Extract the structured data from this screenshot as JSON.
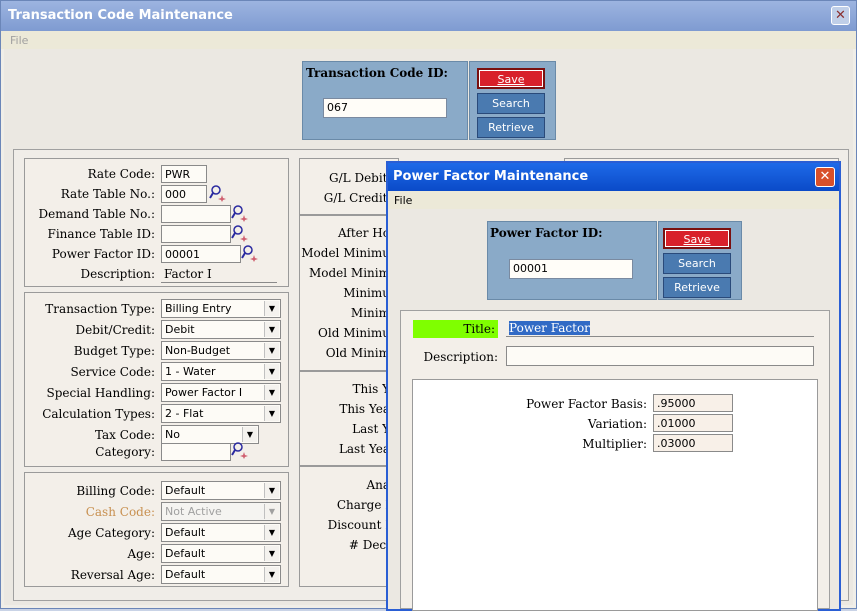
{
  "main": {
    "title": "Transaction Code Maintenance",
    "menu": [
      "File"
    ],
    "id_label": "Transaction Code ID:",
    "id_value": "067",
    "buttons": {
      "save": "Save",
      "search": "Search",
      "retrieve": "Retrieve"
    },
    "group1": {
      "rate_code_label": "Rate Code:",
      "rate_code": "PWR",
      "rate_table_label": "Rate Table No.:",
      "rate_table": "000",
      "demand_table_label": "Demand Table No.:",
      "demand_table": "",
      "finance_table_label": "Finance Table ID:",
      "finance_table": "",
      "power_factor_label": "Power Factor ID:",
      "power_factor": "00001",
      "description_label": "Description:",
      "description": "Factor I"
    },
    "group2": {
      "transaction_type_label": "Transaction Type:",
      "transaction_type": "Billing Entry",
      "debit_credit_label": "Debit/Credit:",
      "debit_credit": "Debit",
      "budget_type_label": "Budget Type:",
      "budget_type": "Non-Budget",
      "service_code_label": "Service Code:",
      "service_code": "1 - Water",
      "special_handling_label": "Special Handling:",
      "special_handling": "Power Factor I",
      "calculation_types_label": "Calculation Types:",
      "calculation_types": "2 - Flat",
      "tax_code_label": "Tax Code:",
      "tax_code": "No",
      "category_label": "Category:",
      "category": ""
    },
    "group3": {
      "billing_code_label": "Billing Code:",
      "billing_code": "Default",
      "cash_code_label": "Cash Code:",
      "cash_code": "Not Active",
      "age_category_label": "Age Category:",
      "age_category": "Default",
      "age_label": "Age:",
      "age": "Default",
      "reversal_age_label": "Reversal Age:",
      "reversal_age": "Default"
    },
    "mid": {
      "gl_debit": "G/L Debit A",
      "gl_credit": "G/L Credit A",
      "after_ho": "After Ho",
      "model_min1": "Model Minimu",
      "model_min2": "Model Minim",
      "minimu": "Minimu",
      "minim": "Minim",
      "old_min1": "Old Minimu",
      "old_min2": "Old Minim",
      "this_y": "This Y",
      "this_yea": "This Yea",
      "last_y": "Last Y",
      "last_yea": "Last Yea",
      "ana": "Ana",
      "charge": "Charge I",
      "discount": "Discount I",
      "deci": "# Deci"
    }
  },
  "dialog": {
    "title": "Power Factor Maintenance",
    "menu": [
      "File"
    ],
    "id_label": "Power Factor ID:",
    "id_value": "00001",
    "buttons": {
      "save": "Save",
      "search": "Search",
      "retrieve": "Retrieve"
    },
    "title_label": "Title:",
    "title_value": "Power Factor",
    "description_label": "Description:",
    "description_value": "",
    "basis_label": "Power Factor Basis:",
    "basis": ".95000",
    "variation_label": "Variation:",
    "variation": ".01000",
    "multiplier_label": "Multiplier:",
    "multiplier": ".03000"
  },
  "colors": {
    "accent_green": "#7fff00",
    "save_red": "#d8202a",
    "panel_blue": "#8aaac8"
  }
}
